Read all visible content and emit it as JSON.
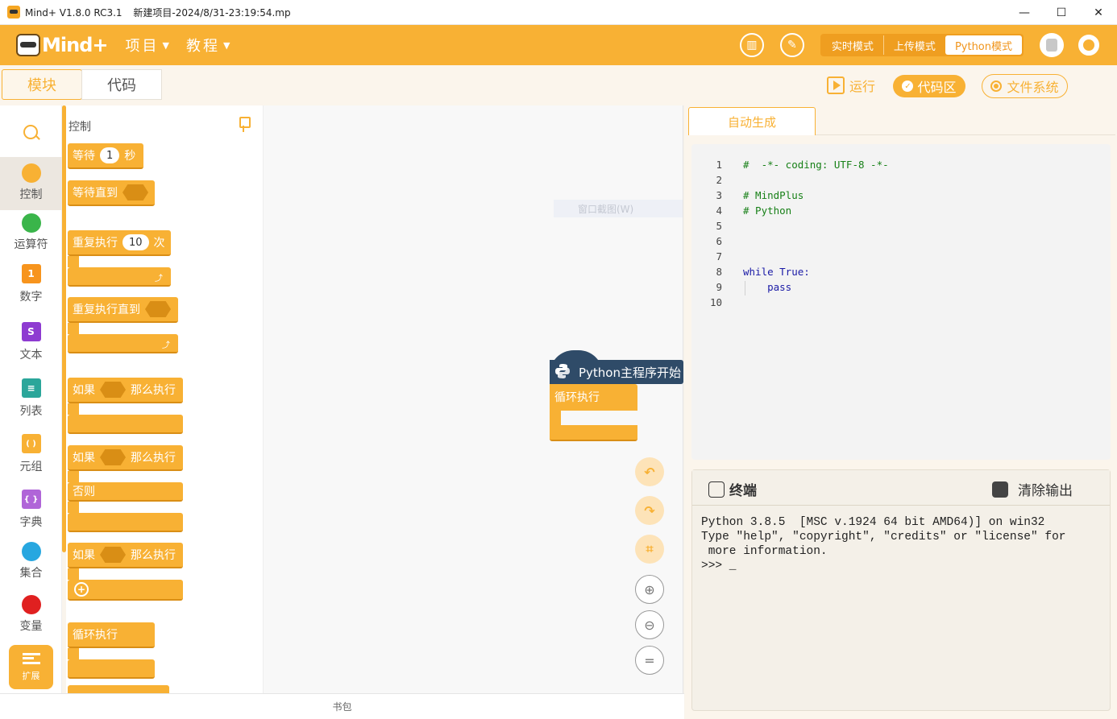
{
  "window": {
    "app_name": "Mind+ V1.8.0 RC3.1",
    "project_name": "新建项目-2024/8/31-23:19:54.mp",
    "minimize": "—",
    "maximize": "☐",
    "close": "✕"
  },
  "header": {
    "logo_text": "Mind+",
    "menu": [
      {
        "label": "项目",
        "caret": "▼"
      },
      {
        "label": "教程",
        "caret": "▼"
      }
    ],
    "modes": [
      "实时模式",
      "上传模式",
      "Python模式"
    ],
    "active_mode": "Python模式"
  },
  "toolbar": {
    "tab_blocks": "模块",
    "tab_code": "代码",
    "run": "运行",
    "code_area": "代码区",
    "file_system": "文件系统"
  },
  "categories": [
    {
      "label": "控制",
      "color": "#f8b134"
    },
    {
      "label": "运算符",
      "color": "#3ab54a"
    },
    {
      "label": "数字",
      "color": "#f7941d",
      "glyph": "1"
    },
    {
      "label": "文本",
      "color": "#8e3bd1",
      "glyph": "S"
    },
    {
      "label": "列表",
      "color": "#2ba69a",
      "glyph": "≡"
    },
    {
      "label": "元组",
      "color": "#f8b134",
      "glyph": "( )"
    },
    {
      "label": "字典",
      "color": "#b065d8",
      "glyph": "{ }"
    },
    {
      "label": "集合",
      "color": "#27a7e0"
    },
    {
      "label": "变量",
      "color": "#e02020"
    }
  ],
  "extensions_label": "扩展",
  "palette": {
    "title": "控制",
    "blocks": {
      "wait": "等待",
      "wait_value": "1",
      "wait_unit": "秒",
      "wait_until": "等待直到",
      "repeat": "重复执行",
      "repeat_value": "10",
      "repeat_unit": "次",
      "repeat_until": "重复执行直到",
      "if": "如果",
      "then": "那么执行",
      "else": "否则",
      "loop": "循环执行"
    }
  },
  "canvas": {
    "ghost_menu": "窗口截图(W)",
    "main_block": "Python主程序开始",
    "loop_block": "循环执行"
  },
  "bottom_bar": "书包",
  "code_panel": {
    "tab": "自动生成",
    "lines": [
      {
        "n": "1",
        "text": "#  -*- coding: UTF-8 -*-",
        "kind": "comment"
      },
      {
        "n": "2",
        "text": "",
        "kind": "plain"
      },
      {
        "n": "3",
        "text": "# MindPlus",
        "kind": "comment"
      },
      {
        "n": "4",
        "text": "# Python",
        "kind": "comment"
      },
      {
        "n": "5",
        "text": "",
        "kind": "plain"
      },
      {
        "n": "6",
        "text": "",
        "kind": "plain"
      },
      {
        "n": "7",
        "text": "",
        "kind": "plain"
      },
      {
        "n": "8",
        "text": "while True:",
        "kind": "kw"
      },
      {
        "n": "9",
        "text": "    pass",
        "kind": "kw"
      },
      {
        "n": "10",
        "text": "",
        "kind": "plain"
      }
    ]
  },
  "terminal": {
    "title": "终端",
    "clear": "清除输出",
    "lines": [
      "Python 3.8.5  [MSC v.1924 64 bit AMD64)] on win32",
      "Type \"help\", \"copyright\", \"credits\" or \"license\" for",
      " more information.",
      ">>> _"
    ]
  }
}
